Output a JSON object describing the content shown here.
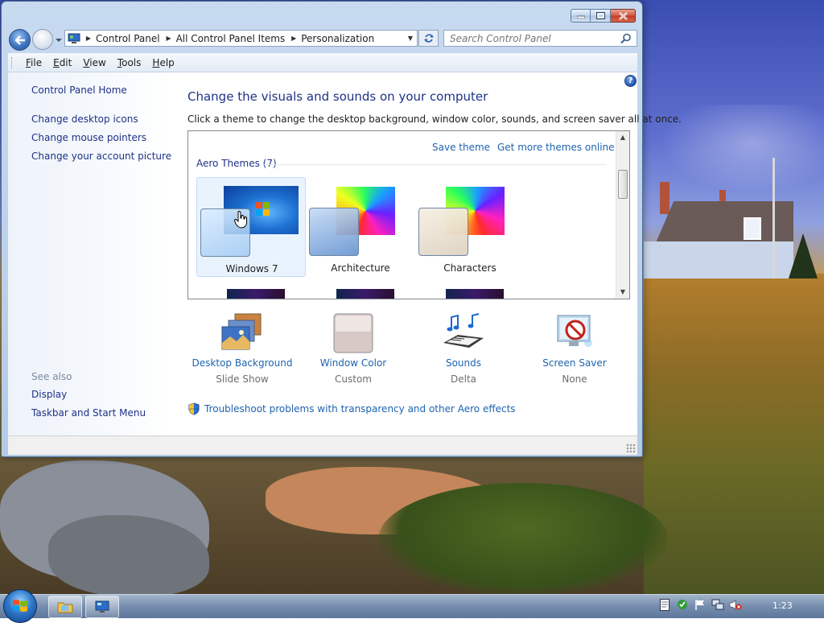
{
  "window": {
    "caption_buttons": {
      "minimize": "minimize-icon",
      "maximize": "maximize-icon",
      "close": "close-icon"
    }
  },
  "address": {
    "breadcrumbs": [
      "Control Panel",
      "All Control Panel Items",
      "Personalization"
    ]
  },
  "search": {
    "placeholder": "Search Control Panel"
  },
  "menu": {
    "items": [
      {
        "access_key": "F",
        "rest": "ile"
      },
      {
        "access_key": "E",
        "rest": "dit"
      },
      {
        "access_key": "V",
        "rest": "iew"
      },
      {
        "access_key": "T",
        "rest": "ools"
      },
      {
        "access_key": "H",
        "rest": "elp"
      }
    ]
  },
  "sidebar": {
    "home": "Control Panel Home",
    "links": [
      "Change desktop icons",
      "Change mouse pointers",
      "Change your account picture"
    ],
    "see_also_heading": "See also",
    "see_also": [
      "Display",
      "Taskbar and Start Menu"
    ]
  },
  "main": {
    "title": "Change the visuals and sounds on your computer",
    "description": "Click a theme to change the desktop background, window color, sounds, and screen saver all at once.",
    "save_theme": "Save theme",
    "get_more_themes": "Get more themes online",
    "aero_header": "Aero Themes (7)",
    "themes": [
      {
        "label": "Windows 7",
        "selected": true
      },
      {
        "label": "Architecture",
        "selected": false
      },
      {
        "label": "Characters",
        "selected": false
      }
    ],
    "options": [
      {
        "label": "Desktop Background",
        "value": "Slide Show",
        "icon": "desktop-background-icon"
      },
      {
        "label": "Window Color",
        "value": "Custom",
        "icon": "window-color-icon"
      },
      {
        "label": "Sounds",
        "value": "Delta",
        "icon": "sounds-icon"
      },
      {
        "label": "Screen Saver",
        "value": "None",
        "icon": "screen-saver-icon"
      }
    ],
    "troubleshoot": "Troubleshoot problems with transparency and other Aero effects"
  },
  "taskbar": {
    "clock": "1:23",
    "tray_icons": [
      "notes-icon",
      "security-icon",
      "flag-icon",
      "network-icon",
      "volume-muted-icon"
    ]
  },
  "colors": {
    "link": "#1e63b0",
    "heading": "#1e3287",
    "selection": "#e9f3fd"
  }
}
